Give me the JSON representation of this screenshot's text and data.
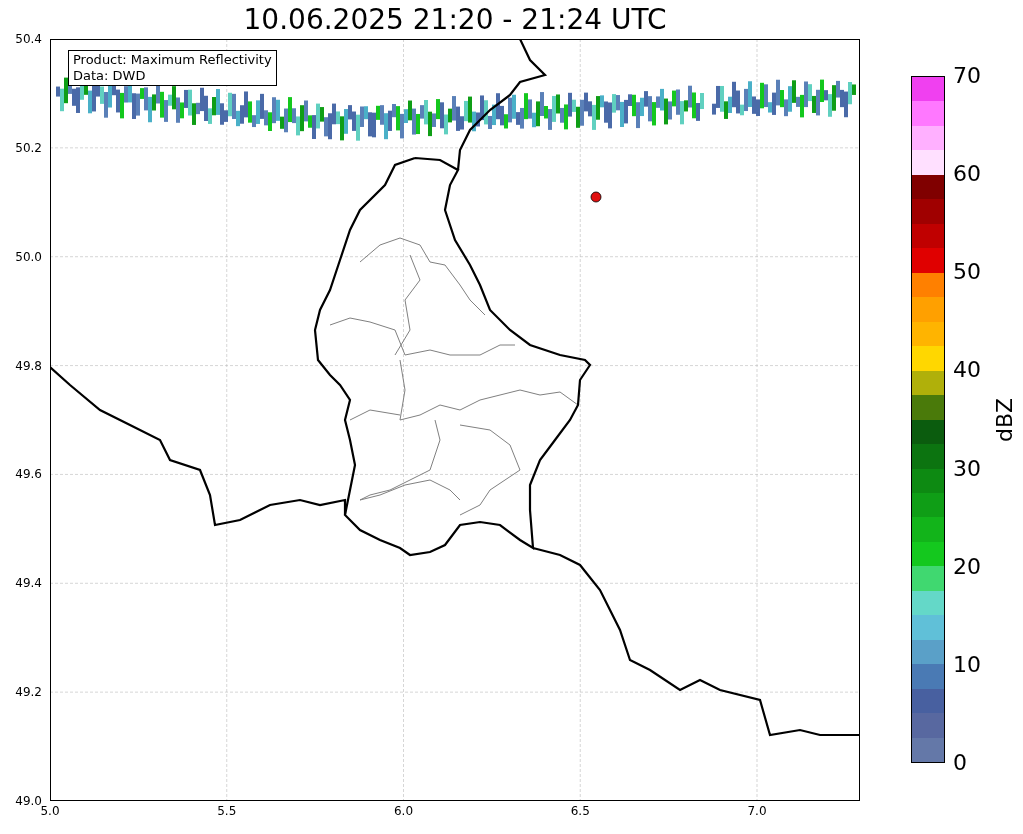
{
  "title": "10.06.2025 21:20 - 21:24 UTC",
  "map": {
    "info_box": [
      "Product: Maximum Reflectivity",
      "Data: DWD"
    ],
    "x_ticks": [
      "5.0",
      "5.5",
      "6.0",
      "6.5",
      "7.0"
    ],
    "y_ticks": [
      "50.4",
      "50.2",
      "50.0",
      "49.8",
      "49.6",
      "49.4",
      "49.2",
      "49.0"
    ]
  },
  "colorbar": {
    "label": "dBZ",
    "ticks": [
      "70",
      "60",
      "50",
      "40",
      "30",
      "20",
      "10",
      "0"
    ],
    "bands": [
      {
        "color": "#f040f0"
      },
      {
        "color": "#ff78ff"
      },
      {
        "color": "#ffb0ff"
      },
      {
        "color": "#ffe0ff"
      },
      {
        "color": "#800000"
      },
      {
        "color": "#a00000"
      },
      {
        "color": "#c00000"
      },
      {
        "color": "#e00000"
      },
      {
        "color": "#ff8000"
      },
      {
        "color": "#ffa000"
      },
      {
        "color": "#ffb400"
      },
      {
        "color": "#ffd700"
      },
      {
        "color": "#b0b00a"
      },
      {
        "color": "#4a7a0a"
      },
      {
        "color": "#0b5c0e"
      },
      {
        "color": "#0c7410"
      },
      {
        "color": "#0d8a12"
      },
      {
        "color": "#0f9e16"
      },
      {
        "color": "#12b41a"
      },
      {
        "color": "#14c81e"
      },
      {
        "color": "#40d870"
      },
      {
        "color": "#64d8c8"
      },
      {
        "color": "#60c0d8"
      },
      {
        "color": "#5aa0c8"
      },
      {
        "color": "#4a7ab4"
      },
      {
        "color": "#4860a0"
      },
      {
        "color": "#5868a0"
      },
      {
        "color": "#6478a8"
      }
    ]
  }
}
